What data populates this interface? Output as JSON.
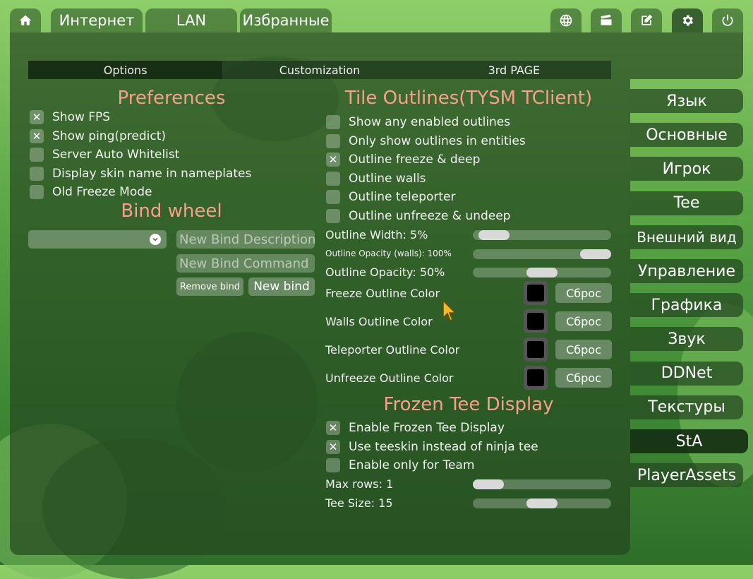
{
  "top_tabs": [
    {
      "label": "Интернет"
    },
    {
      "label": "LAN"
    },
    {
      "label": "Избранные"
    }
  ],
  "icons": {
    "home": "home-icon",
    "globe": "globe-icon",
    "demo": "clapperboard-icon",
    "editor": "edit-icon",
    "settings": "gear-icon",
    "quit": "power-icon"
  },
  "subtabs": [
    "Options",
    "Customization",
    "3rd PAGE"
  ],
  "preferences": {
    "title": "Preferences",
    "items": [
      {
        "label": "Show FPS",
        "checked": true
      },
      {
        "label": "Show ping(predict)",
        "checked": true
      },
      {
        "label": "Server Auto Whitelist",
        "checked": false
      },
      {
        "label": "Display skin name in nameplates",
        "checked": false
      },
      {
        "label": "Old Freeze Mode",
        "checked": false
      }
    ]
  },
  "bind_wheel": {
    "title": "Bind wheel",
    "description_placeholder": "New Bind Description",
    "command_placeholder": "New Bind Command",
    "remove_label": "Remove bind",
    "new_label": "New bind"
  },
  "tile_outlines": {
    "title": "Tile Outlines(TYSM TClient)",
    "items": [
      {
        "label": "Show any enabled outlines",
        "checked": false
      },
      {
        "label": "Only show outlines in entities",
        "checked": false
      },
      {
        "label": "Outline freeze & deep",
        "checked": true
      },
      {
        "label": "Outline walls",
        "checked": false
      },
      {
        "label": "Outline teleporter",
        "checked": false
      },
      {
        "label": "Outline unfreeze & undeep",
        "checked": false
      }
    ],
    "sliders": [
      {
        "label": "Outline Width: 5%",
        "value": 0.05
      },
      {
        "label": "Outline Opacity (walls): 100%",
        "value": 1.0
      },
      {
        "label": "Outline Opacity: 50%",
        "value": 0.5
      }
    ],
    "colors": [
      {
        "label": "Freeze Outline Color",
        "reset": "Сброс",
        "color": "#000000"
      },
      {
        "label": "Walls Outline Color",
        "reset": "Сброс",
        "color": "#000000"
      },
      {
        "label": "Teleporter Outline Color",
        "reset": "Сброс",
        "color": "#000000"
      },
      {
        "label": "Unfreeze Outline Color",
        "reset": "Сброс",
        "color": "#000000"
      }
    ]
  },
  "frozen_tee": {
    "title": "Frozen Tee Display",
    "items": [
      {
        "label": "Enable Frozen Tee Display",
        "checked": true
      },
      {
        "label": "Use teeskin instead of ninja tee",
        "checked": true
      },
      {
        "label": "Enable only for Team",
        "checked": false
      }
    ],
    "sliders": [
      {
        "label": "Max rows: 1",
        "value": 0.0
      },
      {
        "label": "Tee Size: 15",
        "value": 0.5
      }
    ]
  },
  "side_menu": [
    {
      "label": "Язык"
    },
    {
      "label": "Основные"
    },
    {
      "label": "Игрок"
    },
    {
      "label": "Tee"
    },
    {
      "label": "Внешний вид"
    },
    {
      "label": "Управление"
    },
    {
      "label": "Графика"
    },
    {
      "label": "Звук"
    },
    {
      "label": "DDNet"
    },
    {
      "label": "Текстуры"
    },
    {
      "label": "StA"
    },
    {
      "label": "PlayerAssets"
    }
  ],
  "active_side_item": "StA",
  "colors": {
    "accent_title": "#f5a08a"
  }
}
